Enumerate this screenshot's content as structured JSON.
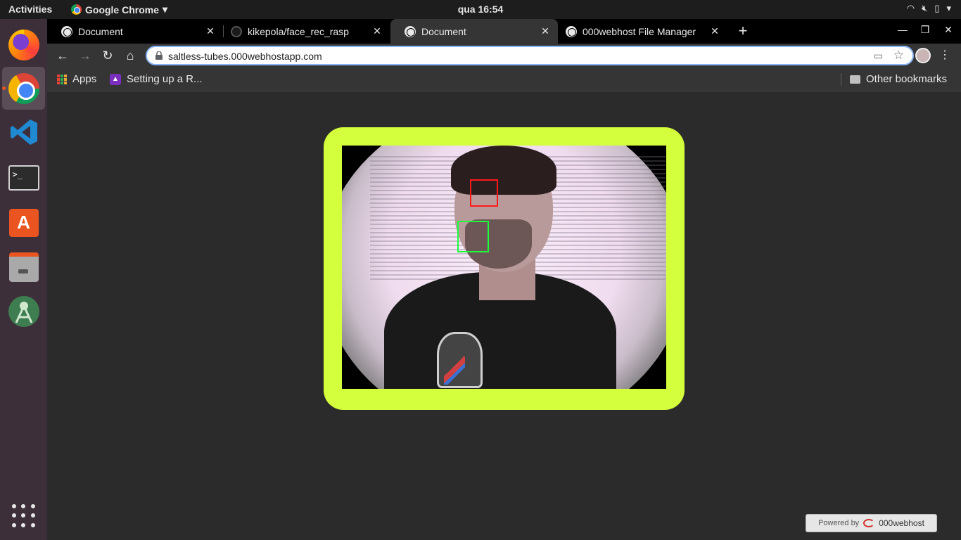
{
  "topbar": {
    "activities": "Activities",
    "app_name": "Google Chrome",
    "clock": "qua 16:54"
  },
  "dock": {
    "apps": [
      "firefox",
      "chrome",
      "vscode",
      "terminal",
      "software-center",
      "files",
      "android-studio"
    ],
    "active": "chrome"
  },
  "tabs": [
    {
      "title": "Document",
      "icon": "globe-icon",
      "active": false
    },
    {
      "title": "kikepola/face_rec_rasp",
      "icon": "github-icon",
      "active": false
    },
    {
      "title": "Document",
      "icon": "globe-icon",
      "active": true
    },
    {
      "title": "000webhost File Manager",
      "icon": "globe-icon",
      "active": false
    }
  ],
  "omnibox": {
    "url": "saltless-tubes.000webhostapp.com"
  },
  "bookmarks": {
    "apps": "Apps",
    "item1": "Setting up a R...",
    "other": "Other bookmarks"
  },
  "page": {
    "frame_color": "#d4ff3c",
    "detections": [
      {
        "label": "eye",
        "color": "#ff1a1a"
      },
      {
        "label": "mouth",
        "color": "#1aff3a"
      }
    ]
  },
  "powered": {
    "prefix": "Powered by",
    "brand": "000webhost"
  },
  "colors": {
    "accent": "#e95420",
    "omnibox_focus": "#8ab4f8"
  }
}
